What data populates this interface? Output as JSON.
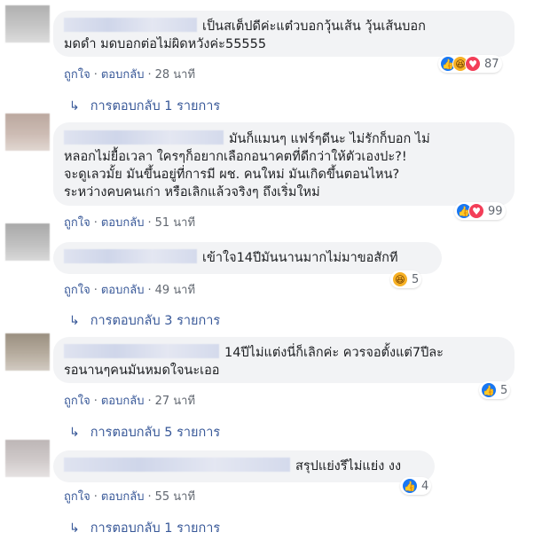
{
  "comments": [
    {
      "lines": [
        "เป็นสเต็ปดีค่ะแต๋วบอกวุ้นเส้น วุ้นเส้นบอก",
        "มดดำ มดบอกต่อไม่ผิดหวังค่ะ55555"
      ],
      "like_label": "ถูกใจ",
      "reply_label": "ตอบกลับ",
      "time": "28 นาที",
      "reactions": [
        "like-icon",
        "haha-icon",
        "love-icon"
      ],
      "reaction_count": "87",
      "replies_label": "การตอบกลับ 1 รายการ"
    },
    {
      "lines": [
        "มันก็แมนๆ แฟร์ๆดีนะ ไม่รักก็บอก ไม่",
        "หลอกไม่ยื้อเวลา ใครๆก็อยากเลือกอนาคตที่ดีกว่าให้ตัวเองปะ?!",
        "จะดูเลวมั้ย มันขึ้นอยู่ที่การมี ผช. คนใหม่ มันเกิดขึ้นตอนไหน?",
        "ระหว่างคบคนเก่า หรือเลิกแล้วจริงๆ ถึงเริ่มใหม่"
      ],
      "like_label": "ถูกใจ",
      "reply_label": "ตอบกลับ",
      "time": "51 นาที",
      "reactions": [
        "like-icon",
        "love-icon"
      ],
      "reaction_count": "99"
    },
    {
      "lines": [
        "เข้าใจ14ปีมันนานมากไม่มาขอสักที"
      ],
      "like_label": "ถูกใจ",
      "reply_label": "ตอบกลับ",
      "time": "49 นาที",
      "reactions": [
        "haha-icon"
      ],
      "reaction_count": "5",
      "replies_label": "การตอบกลับ 3 รายการ"
    },
    {
      "lines": [
        "14ปีไม่แต่งนี่ก็เลิกค่ะ ควรจอตั้งแต่7ปีละ",
        "รอนานๆคนมันหมดใจนะเออ"
      ],
      "like_label": "ถูกใจ",
      "reply_label": "ตอบกลับ",
      "time": "27 นาที",
      "reactions": [
        "like-icon"
      ],
      "reaction_count": "5",
      "replies_label": "การตอบกลับ 5 รายการ"
    },
    {
      "lines": [
        "สรุปแย่งรึไม่แย่ง งง"
      ],
      "like_label": "ถูกใจ",
      "reply_label": "ตอบกลับ",
      "time": "55 นาที",
      "reactions": [
        "like-icon"
      ],
      "reaction_count": "4",
      "replies_label": "การตอบกลับ 1 รายการ"
    }
  ],
  "colors": {
    "bubble": "#f2f3f5",
    "link": "#385898",
    "meta": "#616770",
    "like": "#1877f2",
    "haha": "#f7b125",
    "love": "#f33e58"
  }
}
